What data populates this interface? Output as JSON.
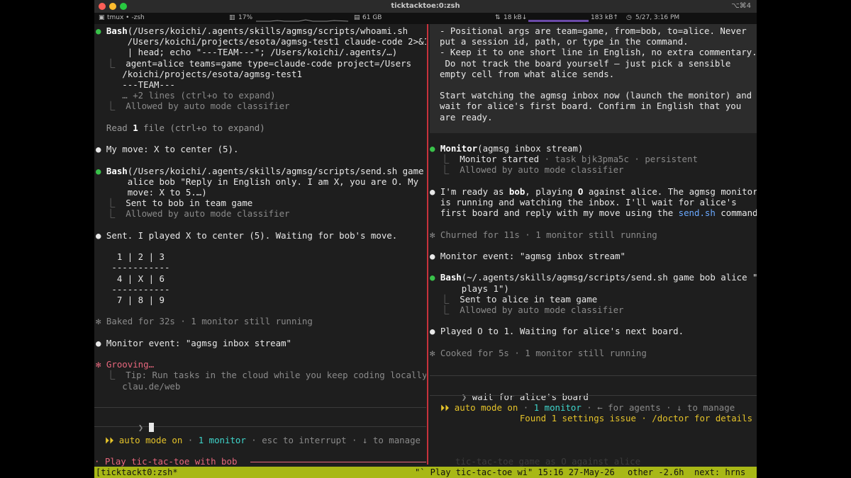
{
  "window": {
    "title": "ticktacktoe:0:zsh",
    "shortcut": "⌥⌘4"
  },
  "statusbar": {
    "tab": "tmux • -zsh",
    "cpu": "17%",
    "disk": "61 GB",
    "net_up": "18 kB↓",
    "net_down": "183 kB↑",
    "clock": "5/27, 3:16 PM"
  },
  "left_pane": {
    "lines": [
      [
        {
          "t": "● ",
          "c": "green"
        },
        {
          "t": "Bash",
          "c": "bold"
        },
        {
          "t": "(/Users/koichi/.agents/skills/agmsg/scripts/whoami.sh",
          "c": "white"
        }
      ],
      [
        {
          "t": "      /Users/koichi/projects/esota/agmsg-test1 claude-code 2>&1",
          "c": "white"
        }
      ],
      [
        {
          "t": "      | head; echo \"---TEAM---\"; /Users/koichi/.agents/…)",
          "c": "white"
        }
      ],
      [
        {
          "t": "  ⎿  ",
          "c": "dim"
        },
        {
          "t": "agent=alice teams=game type=claude-code project=/Users",
          "c": "white"
        }
      ],
      [
        {
          "t": "     /koichi/projects/esota/agmsg-test1",
          "c": "white"
        }
      ],
      [
        {
          "t": "     ---TEAM---",
          "c": "white"
        }
      ],
      [
        {
          "t": "     … +2 lines (ctrl+o to expand)",
          "c": "dim"
        }
      ],
      [
        {
          "t": "  ⎿  Allowed by auto mode classifier",
          "c": "dim"
        }
      ],
      [
        {
          "t": "",
          "c": "white"
        }
      ],
      [
        {
          "t": "  Read ",
          "c": "gray"
        },
        {
          "t": "1",
          "c": "bold"
        },
        {
          "t": " file (ctrl+o to expand)",
          "c": "gray"
        }
      ],
      [
        {
          "t": "",
          "c": "white"
        }
      ],
      [
        {
          "t": "● ",
          "c": "white"
        },
        {
          "t": "My move: X to center (5).",
          "c": "white"
        }
      ],
      [
        {
          "t": "",
          "c": "white"
        }
      ],
      [
        {
          "t": "● ",
          "c": "green"
        },
        {
          "t": "Bash",
          "c": "bold"
        },
        {
          "t": "(/Users/koichi/.agents/skills/agmsg/scripts/send.sh game",
          "c": "white"
        }
      ],
      [
        {
          "t": "      alice bob \"Reply in English only. I am X, you are O. My",
          "c": "white"
        }
      ],
      [
        {
          "t": "      move: X to 5.…)",
          "c": "white"
        }
      ],
      [
        {
          "t": "  ⎿  ",
          "c": "dim"
        },
        {
          "t": "Sent to bob in team game",
          "c": "white"
        }
      ],
      [
        {
          "t": "  ⎿  Allowed by auto mode classifier",
          "c": "dim"
        }
      ],
      [
        {
          "t": "",
          "c": "white"
        }
      ],
      [
        {
          "t": "● ",
          "c": "white"
        },
        {
          "t": "Sent. I played X to center (5). Waiting for bob's move.",
          "c": "white"
        }
      ],
      [
        {
          "t": "",
          "c": "white"
        }
      ],
      [
        {
          "t": "    1 | 2 | 3",
          "c": "white"
        }
      ],
      [
        {
          "t": "   -----------",
          "c": "white"
        }
      ],
      [
        {
          "t": "    4 | X | 6",
          "c": "white"
        }
      ],
      [
        {
          "t": "   -----------",
          "c": "white"
        }
      ],
      [
        {
          "t": "    7 | 8 | 9",
          "c": "white"
        }
      ],
      [
        {
          "t": "",
          "c": "white"
        }
      ],
      [
        {
          "t": "✻ Baked for 32s · 1 monitor still running",
          "c": "dim"
        }
      ],
      [
        {
          "t": "",
          "c": "white"
        }
      ],
      [
        {
          "t": "● ",
          "c": "white"
        },
        {
          "t": "Monitor event: \"agmsg inbox stream\"",
          "c": "white"
        }
      ],
      [
        {
          "t": "",
          "c": "white"
        }
      ],
      [
        {
          "t": "✻ Grooving…",
          "c": "pink"
        }
      ],
      [
        {
          "t": "  ⎿  Tip: Run tasks in the cloud while you keep coding locally ·",
          "c": "dim"
        }
      ],
      [
        {
          "t": "     clau.de/web",
          "c": "dim"
        }
      ]
    ],
    "prompt_symbol": "❯",
    "footer": [
      [
        {
          "t": "  ⏵⏵ auto mode on",
          "c": "yellow"
        },
        {
          "t": " · ",
          "c": "dim"
        },
        {
          "t": "1 monitor",
          "c": "cyan"
        },
        {
          "t": " · esc to interrupt · ↓ to manage",
          "c": "dim"
        }
      ]
    ],
    "session_label": "· Play tic-tac-toe with bob"
  },
  "right_pane": {
    "message_lines": [
      [
        {
          "t": "- Positional args are team=game, from=bob, to=alice. Never",
          "c": "white"
        }
      ],
      [
        {
          "t": "put a session id, path, or type in the command.",
          "c": "white"
        }
      ],
      [
        {
          "t": "- Keep it to one short line in English, no extra commentary.",
          "c": "white"
        }
      ],
      [
        {
          "t": " Do not track the board yourself — just pick a sensible",
          "c": "white"
        }
      ],
      [
        {
          "t": "empty cell from what alice sends.",
          "c": "white"
        }
      ],
      [
        {
          "t": "",
          "c": "white"
        }
      ],
      [
        {
          "t": "Start watching the agmsg inbox now (launch the monitor) and",
          "c": "white"
        }
      ],
      [
        {
          "t": "wait for alice's first board. Confirm in English that you",
          "c": "white"
        }
      ],
      [
        {
          "t": "are ready.",
          "c": "white"
        }
      ]
    ],
    "lines": [
      [
        {
          "t": "● ",
          "c": "green"
        },
        {
          "t": "Monitor",
          "c": "bold"
        },
        {
          "t": "(agmsg inbox stream)",
          "c": "white"
        }
      ],
      [
        {
          "t": "  ⎿  ",
          "c": "dim"
        },
        {
          "t": "Monitor started",
          "c": "white"
        },
        {
          "t": " · task bjk3pma5c · persistent",
          "c": "dim"
        }
      ],
      [
        {
          "t": "  ⎿  Allowed by auto mode classifier",
          "c": "dim"
        }
      ],
      [
        {
          "t": "",
          "c": "white"
        }
      ],
      [
        {
          "t": "● ",
          "c": "white"
        },
        {
          "t": "I'm ready as ",
          "c": "white"
        },
        {
          "t": "bob",
          "c": "bold"
        },
        {
          "t": ", playing ",
          "c": "white"
        },
        {
          "t": "O",
          "c": "bold"
        },
        {
          "t": " against alice. The agmsg monitor",
          "c": "white"
        }
      ],
      [
        {
          "t": "  is running and watching the inbox. I'll wait for alice's",
          "c": "white"
        }
      ],
      [
        {
          "t": "  first board and reply with my move using the ",
          "c": "white"
        },
        {
          "t": "send.sh",
          "c": "blue"
        },
        {
          "t": " command.",
          "c": "white"
        }
      ],
      [
        {
          "t": "",
          "c": "white"
        }
      ],
      [
        {
          "t": "✻ Churned for 11s · 1 monitor still running",
          "c": "dim"
        }
      ],
      [
        {
          "t": "",
          "c": "white"
        }
      ],
      [
        {
          "t": "● ",
          "c": "white"
        },
        {
          "t": "Monitor event: \"agmsg inbox stream\"",
          "c": "white"
        }
      ],
      [
        {
          "t": "",
          "c": "white"
        }
      ],
      [
        {
          "t": "● ",
          "c": "green"
        },
        {
          "t": "Bash",
          "c": "bold"
        },
        {
          "t": "(~/.agents/skills/agmsg/scripts/send.sh game bob alice \"O",
          "c": "white"
        }
      ],
      [
        {
          "t": "      plays 1\")",
          "c": "white"
        }
      ],
      [
        {
          "t": "  ⎿  ",
          "c": "dim"
        },
        {
          "t": "Sent to alice in team game",
          "c": "white"
        }
      ],
      [
        {
          "t": "  ⎿  Allowed by auto mode classifier",
          "c": "dim"
        }
      ],
      [
        {
          "t": "",
          "c": "white"
        }
      ],
      [
        {
          "t": "● ",
          "c": "white"
        },
        {
          "t": "Played O to 1. Waiting for alice's next board.",
          "c": "white"
        }
      ],
      [
        {
          "t": "",
          "c": "white"
        }
      ],
      [
        {
          "t": "✻ Cooked for 5s · 1 monitor still running",
          "c": "dim"
        }
      ]
    ],
    "prompt_symbol": "❯",
    "prompt_text": "wait for alice's board",
    "footer": [
      [
        {
          "t": "  ⏵⏵ auto mode on",
          "c": "yellow"
        },
        {
          "t": " · ",
          "c": "dim"
        },
        {
          "t": "1 monitor",
          "c": "cyan"
        },
        {
          "t": " · ← for agents · ↓ to manage",
          "c": "dim"
        }
      ],
      [
        {
          "t": "                 Found 1 settings issue · /doctor for details",
          "c": "yellow"
        }
      ]
    ],
    "session_label": "tic-tac-toe game as O against alice"
  },
  "tmux_bar": {
    "session": "[ticktackt0:zsh*",
    "pane_title": "\"` Play tic-tac-toe wi\" 15:16 27-May-26",
    "other": "other -2.6h",
    "next": "next: hrns"
  }
}
